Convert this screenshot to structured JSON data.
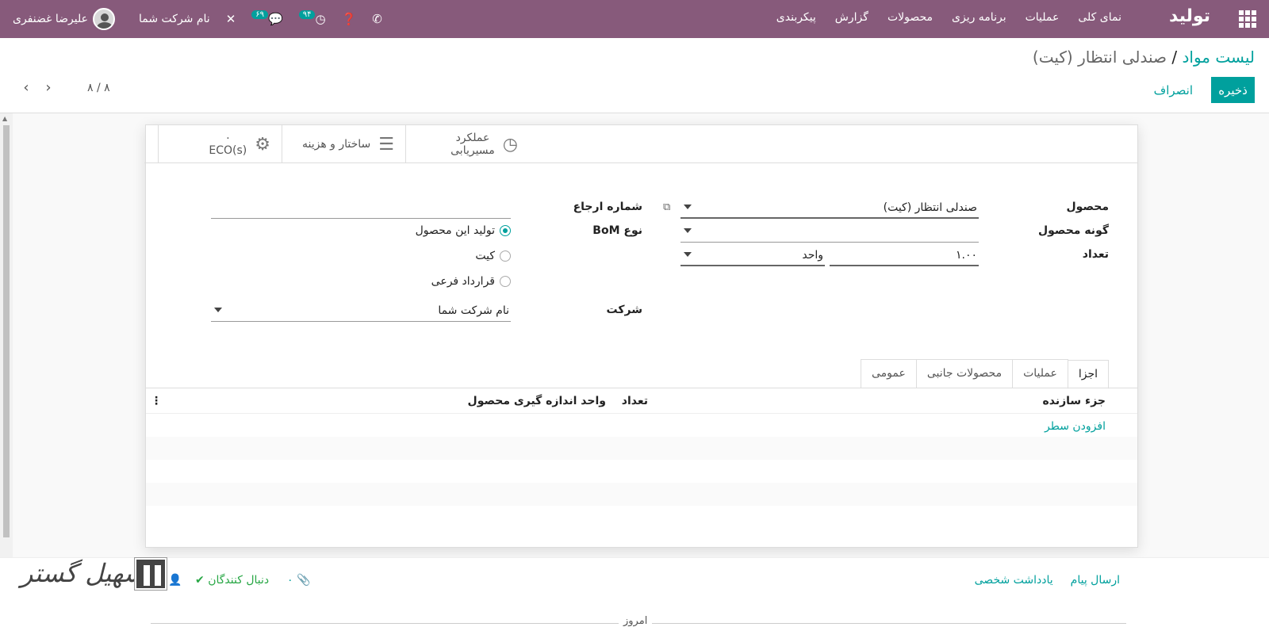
{
  "navbar": {
    "brand": "تولید",
    "menu": [
      "نمای کلی",
      "عملیات",
      "برنامه ریزی",
      "محصولات",
      "گزارش",
      "پیکربندی"
    ],
    "company": "نام شرکت شما",
    "user": "علیرضا غضنفری",
    "messages_count": "۶۹",
    "activities_count": "۹۴"
  },
  "breadcrumb": {
    "parent": "لیست مواد",
    "separator": "/",
    "current": "صندلی انتظار (کیت)"
  },
  "buttons": {
    "save": "ذخیره",
    "discard": "انصراف"
  },
  "pager": {
    "value": "۸ / ۸"
  },
  "stat_buttons": {
    "traceability_line1": "عملکرد",
    "traceability_line2": "مسیریابی",
    "structure": "ساختار و هزینه",
    "eco_count": "۰",
    "eco_label": "ECO(s)"
  },
  "form": {
    "product_label": "محصول",
    "product_value": "صندلی انتظار (کیت)",
    "variant_label": "گونه محصول",
    "variant_value": "",
    "quantity_label": "تعداد",
    "quantity_value": "۱.۰۰",
    "uom_value": "واحد",
    "reference_label": "شماره ارجاع",
    "reference_value": "",
    "bom_type_label": "نوع BoM",
    "bom_type_options": [
      "تولید این محصول",
      "کیت",
      "قرارداد فرعی"
    ],
    "bom_type_selected": 0,
    "company_label": "شرکت",
    "company_value": "نام شرکت شما"
  },
  "tabs": [
    "اجزا",
    "عملیات",
    "محصولات جانبی",
    "عمومی"
  ],
  "table": {
    "col_component": "جزء سازنده",
    "col_quantity": "تعداد",
    "col_uom": "واحد اندازه گیری محصول",
    "add_line": "افزودن سطر"
  },
  "chatter": {
    "send_message": "ارسال پیام",
    "log_note": "یادداشت شخصی",
    "attachments": "۰",
    "followers": "دنبال کنندگان",
    "today": "امروز"
  },
  "watermark": "تسهیل گستر",
  "colors": {
    "navbar": "#875a7b",
    "primary": "#00a09d"
  }
}
